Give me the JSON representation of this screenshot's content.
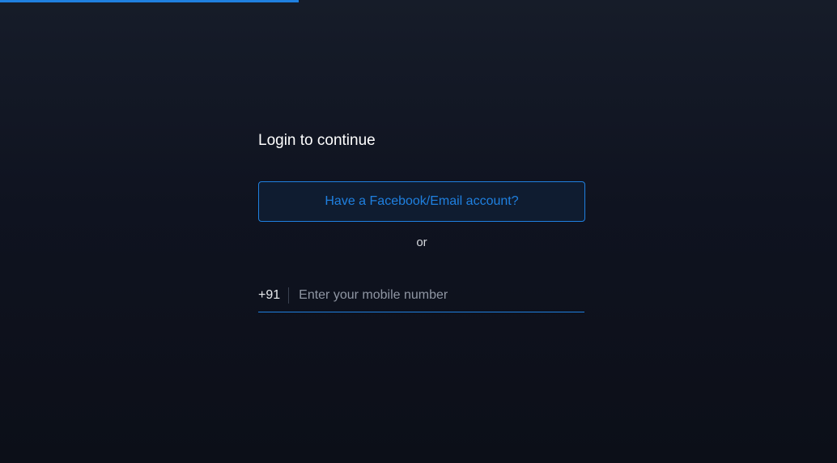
{
  "loader": {
    "progress": 0.357
  },
  "login": {
    "title": "Login to continue",
    "alt_login_label": "Have a Facebook/Email account?",
    "separator": "or",
    "phone": {
      "country_code": "+91",
      "placeholder": "Enter your mobile number",
      "value": ""
    }
  },
  "colors": {
    "accent": "#1f80e0",
    "background": "#0f1320",
    "title_text": "#ffffff",
    "placeholder": "#8f96a3"
  }
}
